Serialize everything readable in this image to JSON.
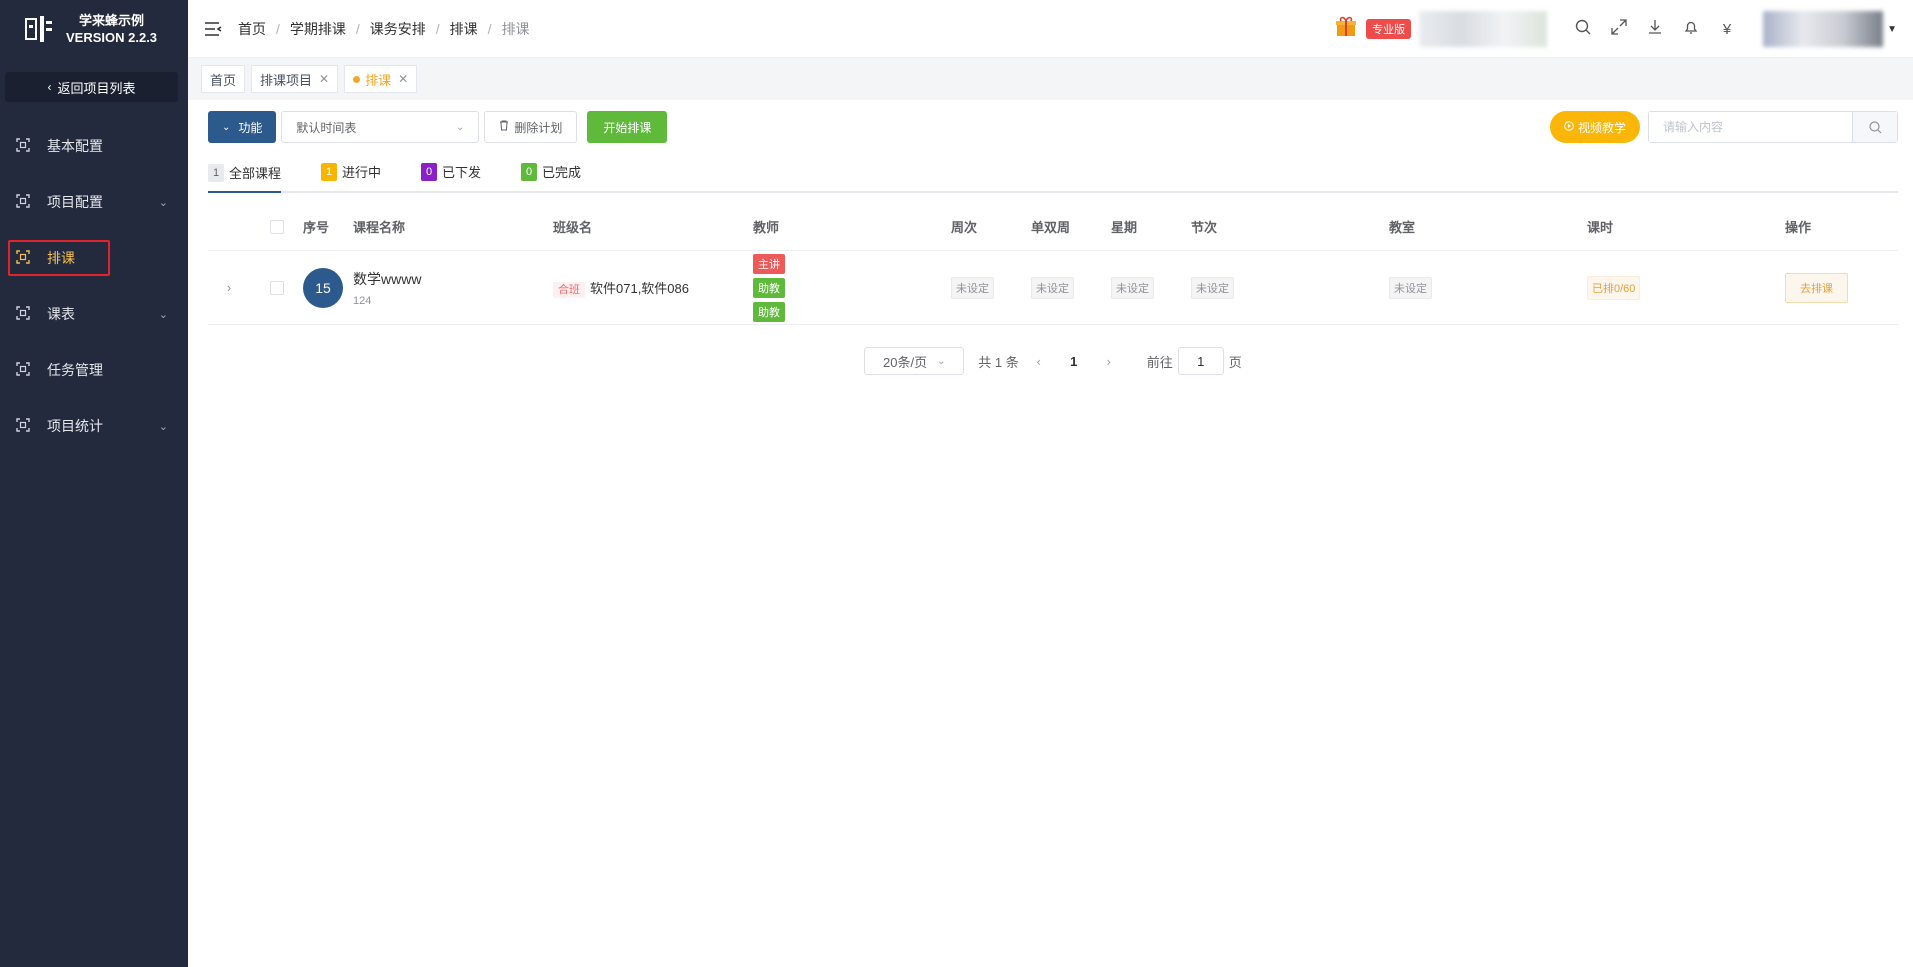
{
  "app": {
    "name": "学来蜂示例",
    "version": "VERSION 2.2.3",
    "back_label": "返回项目列表"
  },
  "sidebar": {
    "items": [
      {
        "label": "基本配置",
        "icon": "scan-icon",
        "has_arrow": false
      },
      {
        "label": "项目配置",
        "icon": "scan-icon",
        "has_arrow": true
      },
      {
        "label": "排课",
        "icon": "scan-icon",
        "has_arrow": false,
        "active": true
      },
      {
        "label": "课表",
        "icon": "scan-icon",
        "has_arrow": true
      },
      {
        "label": "任务管理",
        "icon": "scan-icon",
        "has_arrow": false
      },
      {
        "label": "项目统计",
        "icon": "scan-icon",
        "has_arrow": true
      }
    ]
  },
  "breadcrumb": [
    "首页",
    "学期排课",
    "课务安排",
    "排课",
    "排课"
  ],
  "header": {
    "pro_badge": "专业版",
    "currency_symbol": "¥"
  },
  "tabs": [
    {
      "label": "首页",
      "closable": false
    },
    {
      "label": "排课项目",
      "closable": true
    },
    {
      "label": "排课",
      "closable": true,
      "active": true
    }
  ],
  "toolbar": {
    "func_label": "功能",
    "timetable_select": "默认时间表",
    "delete_label": "删除计划",
    "start_label": "开始排课",
    "video_label": "视频教学",
    "search_placeholder": "请输入内容"
  },
  "status_tabs": [
    {
      "count": "1",
      "label": "全部课程",
      "color": "#e8eaed",
      "text_color": "#606266",
      "active": true
    },
    {
      "count": "1",
      "label": "进行中",
      "color": "#f7b500",
      "text_color": "#ffffff"
    },
    {
      "count": "0",
      "label": "已下发",
      "color": "#8a1fc9",
      "text_color": "#ffffff"
    },
    {
      "count": "0",
      "label": "已完成",
      "color": "#5fba3c",
      "text_color": "#ffffff"
    }
  ],
  "table": {
    "headers": {
      "no": "序号",
      "name": "课程名称",
      "cls": "班级名",
      "teacher": "教师",
      "week": "周次",
      "single_double": "单双周",
      "weekday": "星期",
      "section": "节次",
      "room": "教室",
      "hours": "课时",
      "op": "操作"
    },
    "rows": [
      {
        "no": "15",
        "course": "数学wwww",
        "course_sub": "124",
        "cls_tag": "合班",
        "classes": "软件071,软件086",
        "roles": [
          {
            "label": "主讲",
            "color": "#ee5a5a"
          },
          {
            "label": "助教",
            "color": "#5fba3c"
          },
          {
            "label": "助教",
            "color": "#5fba3c"
          }
        ],
        "week": "未设定",
        "single_double": "未设定",
        "weekday": "未设定",
        "section": "未设定",
        "room": "未设定",
        "hours": "已排0/60",
        "op": "去排课"
      }
    ]
  },
  "pagination": {
    "page_size": "20条/页",
    "total": "共 1 条",
    "current": "1",
    "goto_label": "前往",
    "goto_value": "1",
    "page_suffix": "页"
  }
}
